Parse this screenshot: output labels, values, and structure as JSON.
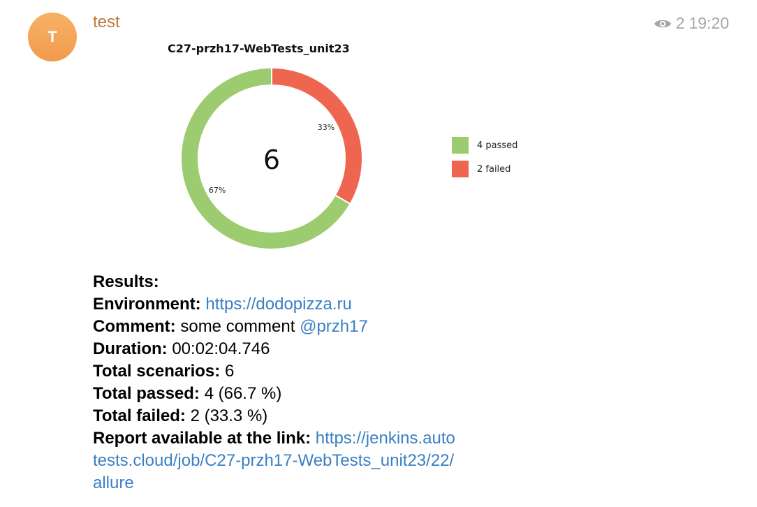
{
  "message": {
    "avatar_letter": "T",
    "sender": "test",
    "views": "2",
    "time": "19:20"
  },
  "chart_data": {
    "type": "pie",
    "title": "C27-przh17-WebTests_unit23",
    "center_label": "6",
    "slices": [
      {
        "name": "4 passed",
        "value": 4,
        "label": "67%",
        "color": "#9dcb6f"
      },
      {
        "name": "2 failed",
        "value": 2,
        "label": "33%",
        "color": "#ee6650"
      }
    ],
    "legend_position": "right"
  },
  "results": {
    "heading": "Results:",
    "environment_key": "Environment:",
    "environment_value": "https://dodopizza.ru",
    "comment_key": "Comment:",
    "comment_value": "some comment",
    "comment_mention": "@przh17",
    "duration_key": "Duration:",
    "duration_value": "00:02:04.746",
    "scenarios_key": "Total scenarios:",
    "scenarios_value": "6",
    "passed_key": "Total passed:",
    "passed_value": "4 (66.7 %)",
    "failed_key": "Total failed:",
    "failed_value": "2 (33.3 %)",
    "report_key": "Report available at the link:",
    "report_link": "https://jenkins.autotests.cloud/job/C27-przh17-WebTests_unit23/22/allure"
  }
}
